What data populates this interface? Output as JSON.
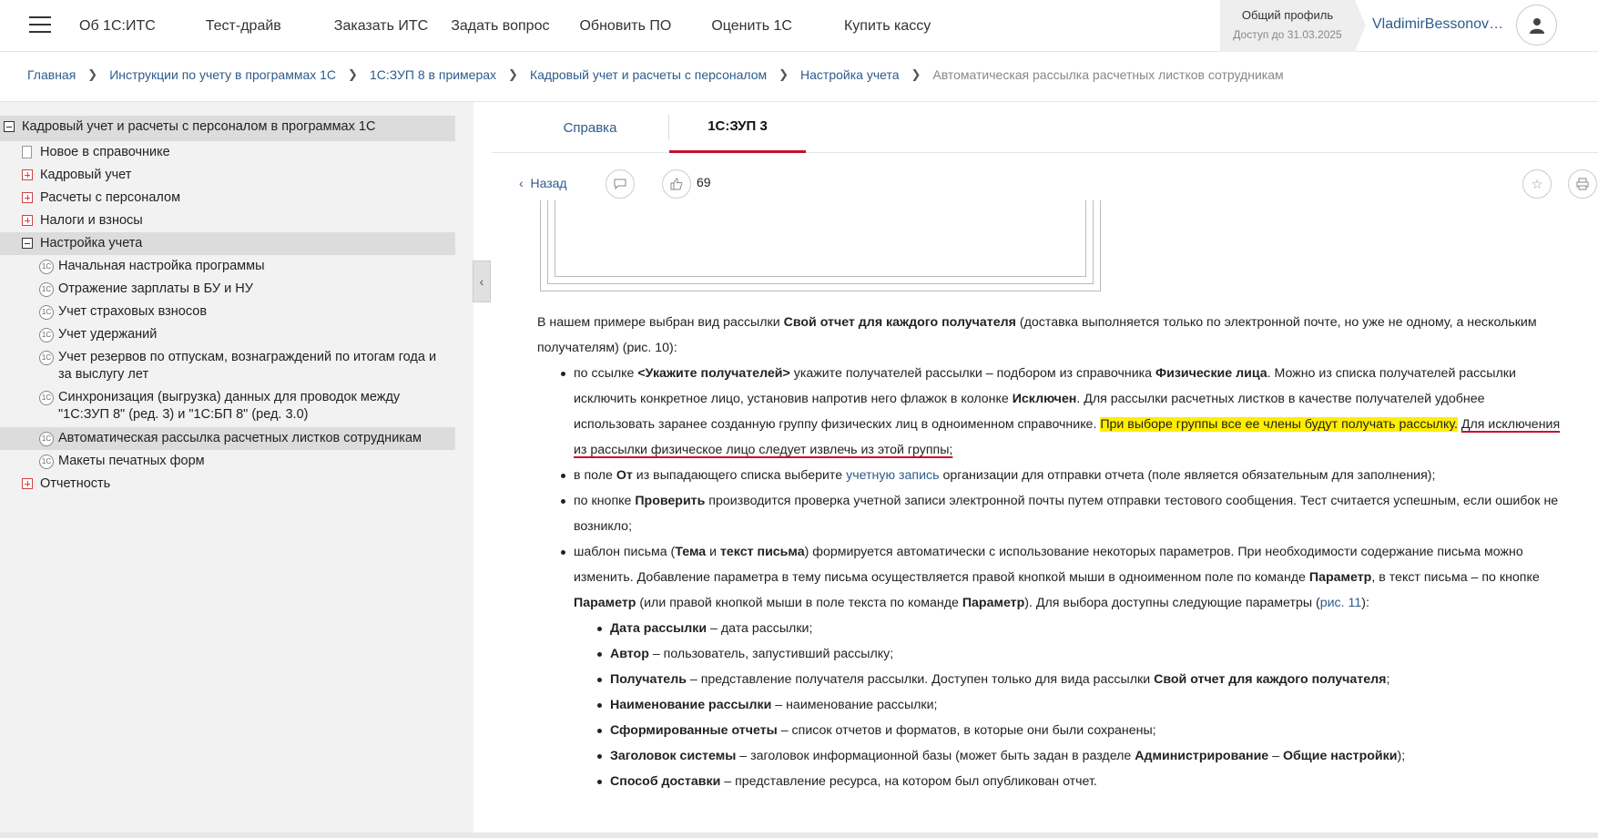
{
  "topnav": {
    "items": [
      "Об 1С:ИТС",
      "Тест-драйв",
      "Заказать ИТС",
      "Задать вопрос",
      "Обновить ПО",
      "Оценить 1С",
      "Купить кассу"
    ]
  },
  "profile": {
    "title": "Общий профиль",
    "subtitle": "Доступ до 31.03.2025",
    "username": "VladimirBessonovKo..."
  },
  "breadcrumb": {
    "items": [
      "Главная",
      "Инструкции по учету в программах 1С",
      "1С:ЗУП 8 в примерах",
      "Кадровый учет и расчеты с персоналом",
      "Настройка учета"
    ],
    "current": "Автоматическая рассылка расчетных листков сотрудникам"
  },
  "sidebar": {
    "root": "Кадровый учет и расчеты с персоналом в программах 1С",
    "items": [
      "Новое в справочнике",
      "Кадровый учет",
      "Расчеты с персоналом",
      "Налоги и взносы",
      "Настройка учета",
      "Отчетность"
    ],
    "sub": [
      "Начальная настройка программы",
      "Отражение зарплаты в БУ и НУ",
      "Учет страховых взносов",
      "Учет удержаний",
      "Учет резервов по отпускам, вознаграждений по итогам года и за выслугу лет",
      "Синхронизация (выгрузка) данных для проводок между \"1С:ЗУП 8\" (ред. 3) и \"1С:БП 8\" (ред. 3.0)",
      "Автоматическая рассылка расчетных листков сотрудникам",
      "Макеты печатных форм"
    ],
    "clock_glyph": "1С"
  },
  "tabs": [
    "Справка",
    "1С:ЗУП 3"
  ],
  "toolbar": {
    "back": "Назад",
    "likes": "69"
  },
  "content": {
    "intro_a": "В нашем примере выбран вид рассылки ",
    "intro_b": "Свой отчет для каждого получателя",
    "intro_c": " (доставка выполняется только по электронной почте, но уже не одному, а нескольким получателям) (рис. 10):",
    "li1_a": "по ссылке ",
    "li1_b": "<Укажите получателей>",
    "li1_c": " укажите получателей рассылки – подбором из справочника ",
    "li1_d": "Физические лица",
    "li1_e": ". Можно из списка получателей рассылки исключить конкретное лицо, установив напротив него флажок в колонке ",
    "li1_f": "Исключен",
    "li1_g": ". Для рассылки расчетных листков в качестве получателей удобнее использовать заранее созданную группу физических лиц в одноименном справочнике. ",
    "li1_h": "При выборе группы все ее члены будут получать рассылку.",
    "li1_i": " ",
    "li1_j": "Для исключения из рассылки физическое лицо следует извлечь из этой группы;",
    "li2_a": "в поле ",
    "li2_b": "От",
    "li2_c": " из выпадающего списка выберите ",
    "li2_d": "учетную запись",
    "li2_e": " организации для отправки отчета (поле является обязательным для заполнения);",
    "li3_a": "по кнопке ",
    "li3_b": "Проверить",
    "li3_c": " производится проверка учетной записи электронной почты путем отправки тестового сообщения. Тест считается успешным, если ошибок не возникло;",
    "li4_a": "шаблон письма (",
    "li4_b": "Тема",
    "li4_c": " и ",
    "li4_d": "текст письма",
    "li4_e": ") формируется автоматически с использование некоторых параметров. При необходимости содержание письма можно изменить. Добавление параметра в тему письма осуществляется правой кнопкой мыши в одноименном поле по команде ",
    "li4_f": "Параметр",
    "li4_g": ", в текст письма – по кнопке ",
    "li4_h": "Параметр",
    "li4_i": " (или правой кнопкой мыши в поле текста по команде ",
    "li4_j": "Параметр",
    "li4_k": "). Для выбора доступны следующие параметры (",
    "li4_l": "рис. 11",
    "li4_m": "):",
    "params": [
      {
        "b": "Дата рассылки",
        "t": " – дата рассылки;"
      },
      {
        "b": "Автор",
        "t": " – пользователь, запустивший рассылку;"
      },
      {
        "b": "Получатель",
        "t": " – представление получателя рассылки. Доступен только для вида рассылки ",
        "b2": "Свой отчет для каждого получателя",
        "t2": ";"
      },
      {
        "b": "Наименование рассылки",
        "t": " – наименование рассылки;"
      },
      {
        "b": "Сформированные отчеты",
        "t": " – список отчетов и форматов, в которые они были сохранены;"
      },
      {
        "b": "Заголовок системы",
        "t": " – заголовок информационной базы (может быть задан в разделе ",
        "b2": "Администрирование",
        "t2": " – ",
        "b3": "Общие настройки",
        "t3": ");"
      },
      {
        "b": "Способ доставки",
        "t": " – представление ресурса, на котором был опубликован отчет."
      }
    ]
  }
}
